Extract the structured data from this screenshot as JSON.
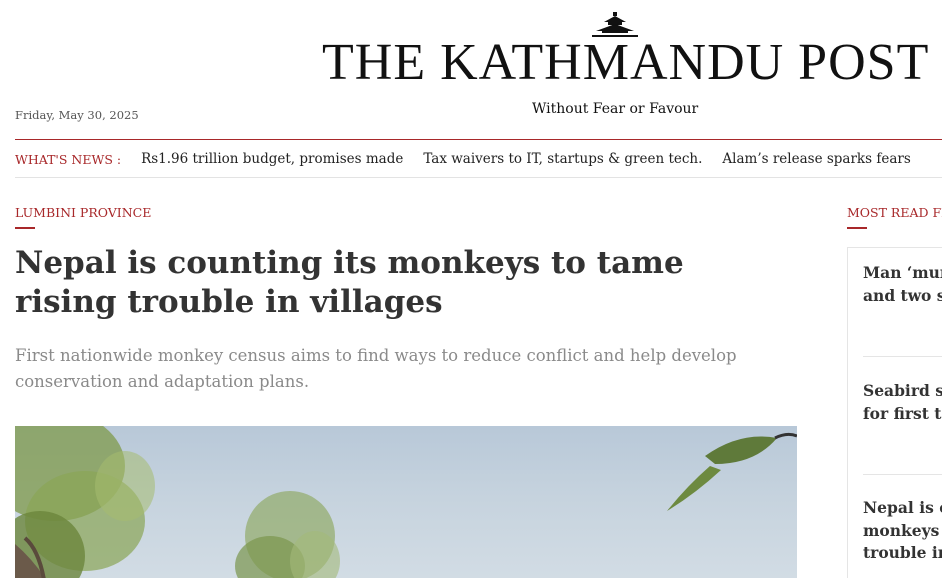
{
  "masthead": {
    "title": "THE KATHMANDU POST",
    "tagline": "Without Fear or Favour",
    "logo_icon": "pagoda-roof-icon",
    "date": "Friday, May 30, 2025"
  },
  "whats_news": {
    "label": "WHAT'S NEWS :",
    "items": [
      "Rs1.96 trillion budget, promises made",
      "Tax waivers to IT, startups & green tech.",
      "Alam’s release sparks fears"
    ]
  },
  "article": {
    "kicker": "LUMBINI PROVINCE",
    "headline": "Nepal is counting its monkeys to tame rising trouble in villages",
    "subhead": "First nationwide monkey census aims to find ways to reduce conflict and help develop conservation and adaptation plans."
  },
  "sidebar": {
    "label": "MOST READ FR",
    "items": [
      "Man ‘mur\nand two st",
      "Seabird sp\nfor first ti",
      "Nepal is co\nmonkeys t\ntrouble in"
    ]
  },
  "colors": {
    "accent": "#a8282a",
    "headline": "#333333",
    "subhead": "#8a8a8a"
  }
}
